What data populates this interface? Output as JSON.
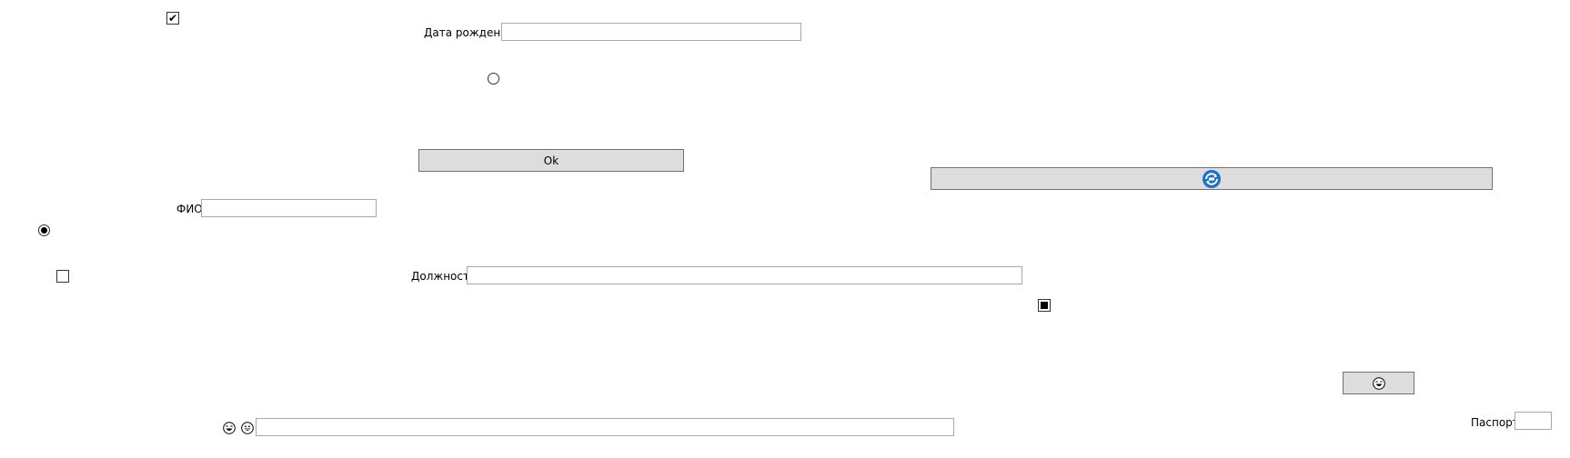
{
  "form": {
    "birth_date": {
      "label": "Дата рождения",
      "value": ""
    },
    "ok_button": {
      "label": "Ok"
    },
    "refresh_button": {
      "icon": "refresh-icon",
      "icon_color": "#1a73c8"
    },
    "fio": {
      "label": "ФИО",
      "value": ""
    },
    "position": {
      "label": "Должность",
      "value": ""
    },
    "emoji_button": {
      "icon": "laughing-emoji-icon"
    },
    "passport": {
      "label": "Паспорт",
      "value": ""
    },
    "bottom_field": {
      "value": "",
      "icons": [
        "laughing-emoji-icon",
        "grinning-emoji-icon"
      ]
    },
    "checkboxes": {
      "top": {
        "state": "checked",
        "glyph": "✔"
      },
      "left": {
        "state": "unchecked"
      },
      "right": {
        "state": "indeterminate"
      }
    },
    "radios": {
      "top": {
        "state": "unselected"
      },
      "left": {
        "state": "selected"
      }
    }
  }
}
